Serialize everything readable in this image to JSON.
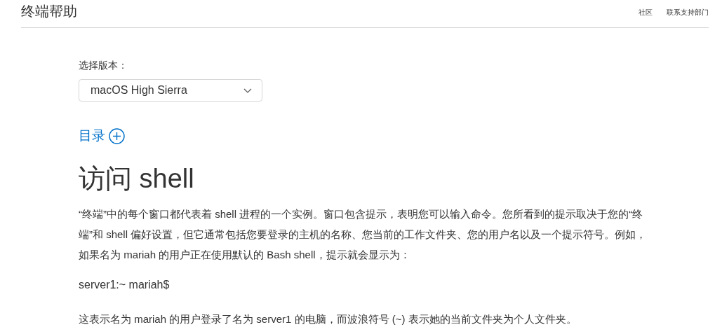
{
  "header": {
    "title": "终端帮助",
    "nav": [
      "社区",
      "联系支持部门"
    ]
  },
  "version_picker": {
    "label": "选择版本：",
    "value": "macOS High Sierra"
  },
  "toc": {
    "label": "目录",
    "expanded": false
  },
  "article": {
    "heading": "访问 shell",
    "paragraphs": [
      {
        "kind": "text",
        "text": "“终端”中的每个窗口都代表着 shell 进程的一个实例。窗口包含提示，表明您可以输入命令。您所看到的提示取决于您的“终端”和 shell 偏好设置，但它通常包括您要登录的主机的名称、您当前的工作文件夹、您的用户名以及一个提示符号。例如，如果名为 mariah 的用户正在使用默认的 Bash shell，提示就会显示为："
      },
      {
        "kind": "code",
        "text": "server1:~ mariah$"
      },
      {
        "kind": "text",
        "text": "这表示名为 mariah 的用户登录了名为 server1 的电脑，而波浪符号 (~) 表示她的当前文件夹为个人文件夹。"
      }
    ]
  }
}
